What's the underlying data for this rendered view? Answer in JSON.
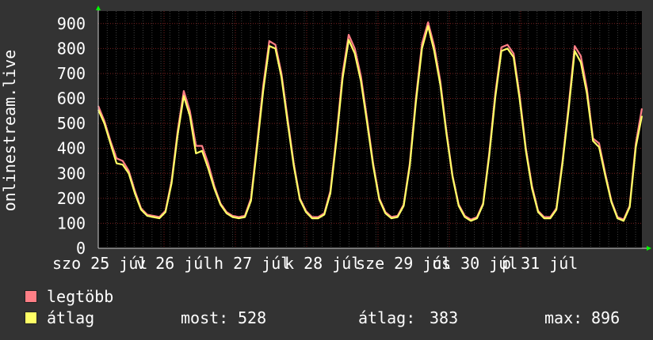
{
  "chart_data": {
    "type": "line",
    "ylabel": "onlinestream.live",
    "ylim": [
      0,
      950
    ],
    "yticks": [
      0,
      100,
      200,
      300,
      400,
      500,
      600,
      700,
      800,
      900
    ],
    "x_tick_labels": [
      "szo 25 júl",
      "v 26 júl",
      "h 27 júl",
      "k 28 júl",
      "sze 29 júl",
      "cs 30 júl",
      "p 31 júl"
    ],
    "grid": true,
    "colors": {
      "background": "#333333",
      "plot_bg": "#000000",
      "grid": "#404040",
      "grid_major": "#7a2020",
      "text": "#ffffff",
      "max_series": "#ff7f86",
      "avg_series": "#ffff66",
      "axis_arrow": "#00ff00"
    },
    "series": [
      {
        "name": "legtöbb",
        "color": "#ff7f86",
        "values": [
          570,
          510,
          430,
          360,
          350,
          310,
          230,
          160,
          135,
          130,
          125,
          150,
          270,
          470,
          630,
          550,
          410,
          410,
          340,
          250,
          180,
          145,
          130,
          125,
          130,
          200,
          420,
          650,
          830,
          815,
          700,
          520,
          340,
          200,
          150,
          125,
          125,
          140,
          230,
          450,
          700,
          855,
          800,
          690,
          520,
          340,
          200,
          145,
          125,
          130,
          175,
          340,
          600,
          820,
          905,
          810,
          670,
          470,
          290,
          175,
          130,
          115,
          125,
          180,
          380,
          620,
          805,
          815,
          780,
          610,
          400,
          250,
          150,
          125,
          125,
          160,
          350,
          570,
          810,
          770,
          640,
          440,
          420,
          300,
          190,
          125,
          115,
          170,
          420,
          560
        ]
      },
      {
        "name": "átlag",
        "color": "#ffff66",
        "values": [
          555,
          500,
          420,
          340,
          335,
          300,
          220,
          155,
          130,
          125,
          120,
          145,
          260,
          455,
          610,
          530,
          380,
          390,
          320,
          240,
          175,
          140,
          125,
          120,
          125,
          190,
          405,
          630,
          810,
          800,
          685,
          505,
          330,
          195,
          145,
          120,
          120,
          135,
          220,
          435,
          680,
          835,
          780,
          670,
          505,
          330,
          195,
          140,
          120,
          125,
          170,
          330,
          585,
          800,
          890,
          790,
          655,
          460,
          285,
          170,
          125,
          110,
          120,
          175,
          370,
          605,
          790,
          800,
          765,
          595,
          390,
          240,
          145,
          120,
          120,
          155,
          340,
          555,
          790,
          745,
          620,
          430,
          405,
          290,
          185,
          120,
          110,
          165,
          405,
          530
        ]
      }
    ],
    "stats": {
      "current_label": "most:",
      "current": 528,
      "average_label": "átlag:",
      "average": 383,
      "max_label": "max:",
      "max": 896
    }
  }
}
